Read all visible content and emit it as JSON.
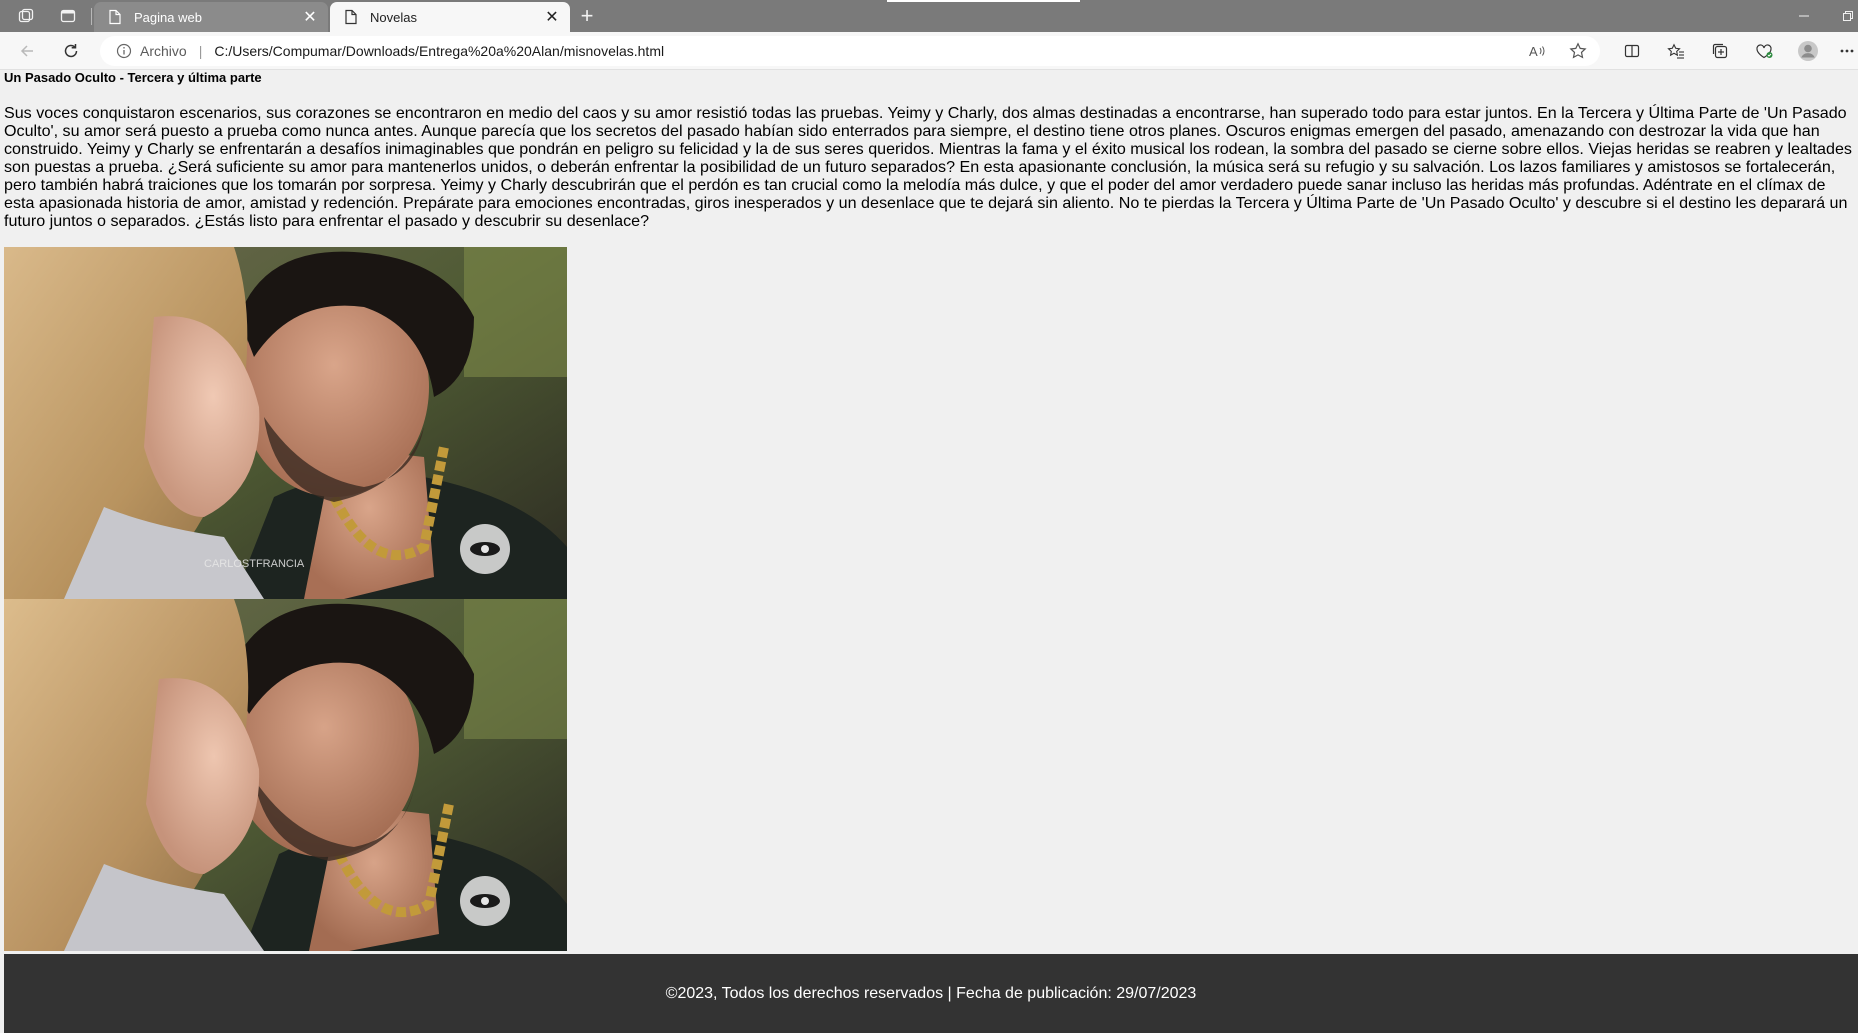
{
  "browser": {
    "tabs": [
      {
        "title": "Pagina web",
        "close": "✕"
      },
      {
        "title": "Novelas",
        "close": "✕"
      }
    ],
    "new_tab": "+",
    "address": {
      "scheme_label": "Archivo",
      "url": "C:/Users/Compumar/Downloads/Entrega%20a%20Alan/misnovelas.html"
    }
  },
  "page": {
    "title": "Un Pasado Oculto - Tercera y última parte",
    "description": "Sus voces conquistaron escenarios, sus corazones se encontraron en medio del caos y su amor resistió todas las pruebas. Yeimy y Charly, dos almas destinadas a encontrarse, han superado todo para estar juntos. En la Tercera y Última Parte de 'Un Pasado Oculto', su amor será puesto a prueba como nunca antes. Aunque parecía que los secretos del pasado habían sido enterrados para siempre, el destino tiene otros planes. Oscuros enigmas emergen del pasado, amenazando con destrozar la vida que han construido. Yeimy y Charly se enfrentarán a desafíos inimaginables que pondrán en peligro su felicidad y la de sus seres queridos. Mientras la fama y el éxito musical los rodean, la sombra del pasado se cierne sobre ellos. Viejas heridas se reabren y lealtades son puestas a prueba. ¿Será suficiente su amor para mantenerlos unidos, o deberán enfrentar la posibilidad de un futuro separados? En esta apasionante conclusión, la música será su refugio y su salvación. Los lazos familiares y amistosos se fortalecerán, pero también habrá traiciones que los tomarán por sorpresa. Yeimy y Charly descubrirán que el perdón es tan crucial como la melodía más dulce, y que el poder del amor verdadero puede sanar incluso las heridas más profundas. Adéntrate en el clímax de esta apasionada historia de amor, amistad y redención. Prepárate para emociones encontradas, giros inesperados y un desenlace que te dejará sin aliento. No te pierdas la Tercera y Última Parte de 'Un Pasado Oculto' y descubre si el destino les deparará un futuro juntos o separados. ¿Estás listo para enfrentar el pasado y descubrir su desenlace?",
    "images": [
      {
        "name": "photo-couple-1",
        "watermark": "CARLOSTFRANCIA"
      },
      {
        "name": "photo-couple-2"
      }
    ],
    "footer": "©2023, Todos los derechos reservados | Fecha de publicación: 29/07/2023"
  },
  "colors": {
    "tabbar": "#7a7a7a",
    "page_bg": "#f0f0f0",
    "footer_bg": "#333333"
  },
  "icons": [
    "workspaces-icon",
    "tab-actions-icon",
    "page-icon",
    "back-icon",
    "refresh-icon",
    "info-icon",
    "read-aloud-icon",
    "favorite-star-icon",
    "split-screen-icon",
    "favorites-icon",
    "collections-icon",
    "extensions-icon",
    "profile-avatar-icon",
    "more-icon",
    "caracol-logo-icon"
  ]
}
